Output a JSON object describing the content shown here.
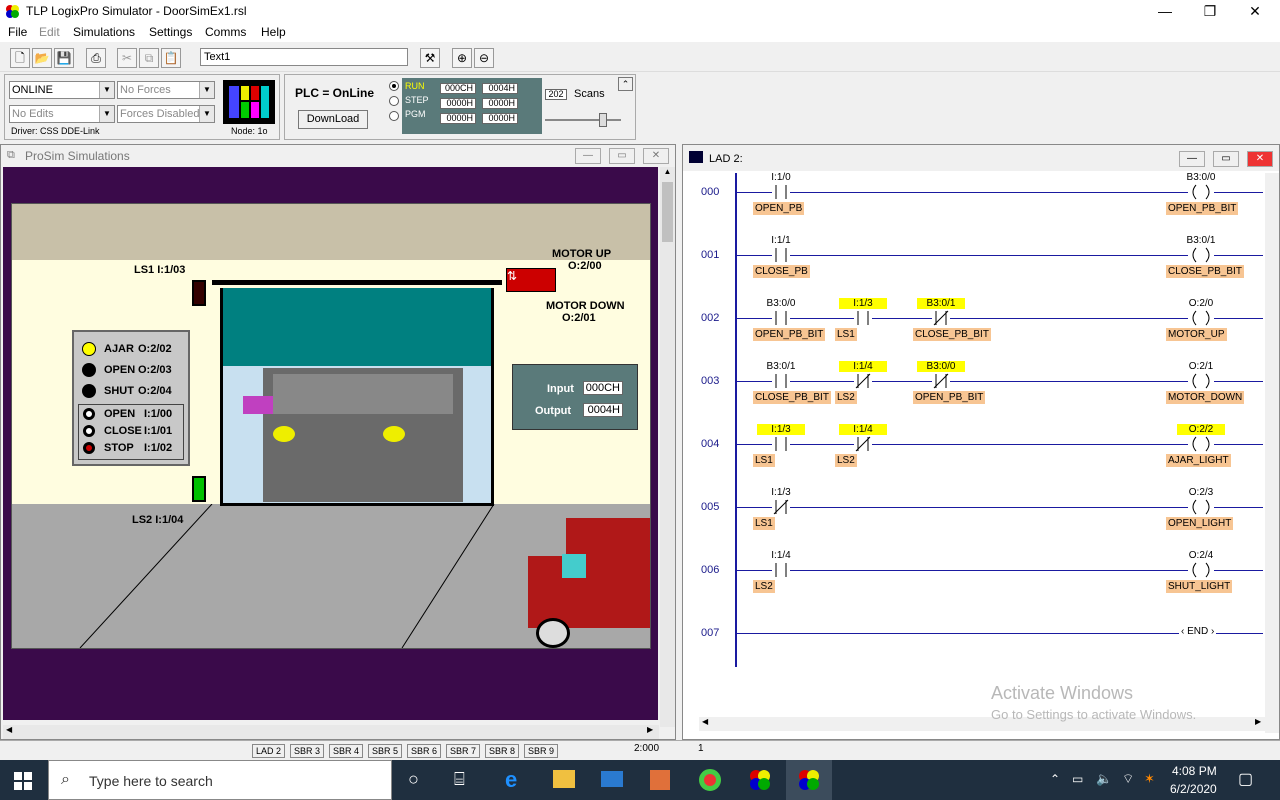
{
  "app": {
    "title": "TLP LogixPro Simulator  -  DoorSimEx1.rsl",
    "min": "—",
    "max": "❐",
    "close": "✕"
  },
  "menu": [
    "File",
    "Edit",
    "Simulations",
    "Settings",
    "Comms",
    "Help"
  ],
  "toolbar": {
    "text_field": "Text1"
  },
  "status_panel": {
    "mode": "ONLINE",
    "forces": "No Forces",
    "edits": "No Edits",
    "forces_state": "Forces Disabled",
    "driver": "Driver: CSS DDE-Link",
    "node": "Node: 1o"
  },
  "plc_panel": {
    "status": "PLC = OnLine",
    "download": "DownLoad",
    "modes": [
      "RUN",
      "STEP",
      "PGM"
    ],
    "regs": [
      [
        "000CH",
        "0004H"
      ],
      [
        "0000H",
        "0000H"
      ],
      [
        "0000H",
        "0000H"
      ]
    ],
    "scans_value": "202",
    "scans_label": "Scans"
  },
  "prosim": {
    "title": "ProSim Simulations",
    "motor_up": "MOTOR UP",
    "motor_up_addr": "O:2/00",
    "motor_down": "MOTOR DOWN",
    "motor_down_addr": "O:2/01",
    "ls1": "LS1  I:1/03",
    "ls2": "LS2  I:1/04",
    "lights": [
      {
        "label": "AJAR",
        "addr": "O:2/02"
      },
      {
        "label": "OPEN",
        "addr": "O:2/03"
      },
      {
        "label": "SHUT",
        "addr": "O:2/04"
      }
    ],
    "buttons": [
      {
        "label": "OPEN",
        "addr": "I:1/00"
      },
      {
        "label": "CLOSE",
        "addr": "I:1/01"
      },
      {
        "label": "STOP",
        "addr": "I:1/02"
      }
    ],
    "input_label": "Input",
    "input_value": "000CH",
    "output_label": "Output",
    "output_value": "0004H",
    "status_value": "2:000"
  },
  "lad": {
    "title": "LAD 2:",
    "status_value": "1",
    "rungs": [
      {
        "num": "000",
        "contacts": [
          {
            "addr": "I:1/0",
            "tag": "OPEN_PB",
            "hl": false,
            "nc": false
          }
        ],
        "coil": {
          "addr": "B3:0/0",
          "tag": "OPEN_PB_BIT",
          "hl": false
        }
      },
      {
        "num": "001",
        "contacts": [
          {
            "addr": "I:1/1",
            "tag": "CLOSE_PB",
            "hl": false,
            "nc": false
          }
        ],
        "coil": {
          "addr": "B3:0/1",
          "tag": "CLOSE_PB_BIT",
          "hl": false
        }
      },
      {
        "num": "002",
        "contacts": [
          {
            "addr": "B3:0/0",
            "tag": "OPEN_PB_BIT",
            "hl": false,
            "nc": false
          },
          {
            "addr": "I:1/3",
            "tag": "LS1",
            "hl": true,
            "nc": false
          },
          {
            "addr": "B3:0/1",
            "tag": "CLOSE_PB_BIT",
            "hl": true,
            "nc": true
          }
        ],
        "coil": {
          "addr": "O:2/0",
          "tag": "MOTOR_UP",
          "hl": false
        }
      },
      {
        "num": "003",
        "contacts": [
          {
            "addr": "B3:0/1",
            "tag": "CLOSE_PB_BIT",
            "hl": false,
            "nc": false
          },
          {
            "addr": "I:1/4",
            "tag": "LS2",
            "hl": true,
            "nc": true
          },
          {
            "addr": "B3:0/0",
            "tag": "OPEN_PB_BIT",
            "hl": true,
            "nc": true
          }
        ],
        "coil": {
          "addr": "O:2/1",
          "tag": "MOTOR_DOWN",
          "hl": false
        }
      },
      {
        "num": "004",
        "contacts": [
          {
            "addr": "I:1/3",
            "tag": "LS1",
            "hl": true,
            "nc": false
          },
          {
            "addr": "I:1/4",
            "tag": "LS2",
            "hl": true,
            "nc": true
          }
        ],
        "coil": {
          "addr": "O:2/2",
          "tag": "AJAR_LIGHT",
          "hl": true
        }
      },
      {
        "num": "005",
        "contacts": [
          {
            "addr": "I:1/3",
            "tag": "LS1",
            "hl": false,
            "nc": true
          }
        ],
        "coil": {
          "addr": "O:2/3",
          "tag": "OPEN_LIGHT",
          "hl": false
        }
      },
      {
        "num": "006",
        "contacts": [
          {
            "addr": "I:1/4",
            "tag": "LS2",
            "hl": false,
            "nc": false
          }
        ],
        "coil": {
          "addr": "O:2/4",
          "tag": "SHUT_LIGHT",
          "hl": false
        }
      },
      {
        "num": "007",
        "contacts": [],
        "coil": {
          "addr": "",
          "tag": "END",
          "hl": false
        }
      }
    ]
  },
  "sheet_tabs": [
    "LAD 2",
    "SBR 3",
    "SBR 4",
    "SBR 5",
    "SBR 6",
    "SBR 7",
    "SBR 8",
    "SBR 9"
  ],
  "watermark": {
    "line1": "Activate Windows",
    "line2": "Go to Settings to activate Windows."
  },
  "taskbar": {
    "search": "Type here to search",
    "time": "4:08 PM",
    "date": "6/2/2020"
  },
  "colors": {
    "highlight": "#ffff00",
    "tag_bg": "#f7c593",
    "rung_line": "#1a1aa0"
  }
}
